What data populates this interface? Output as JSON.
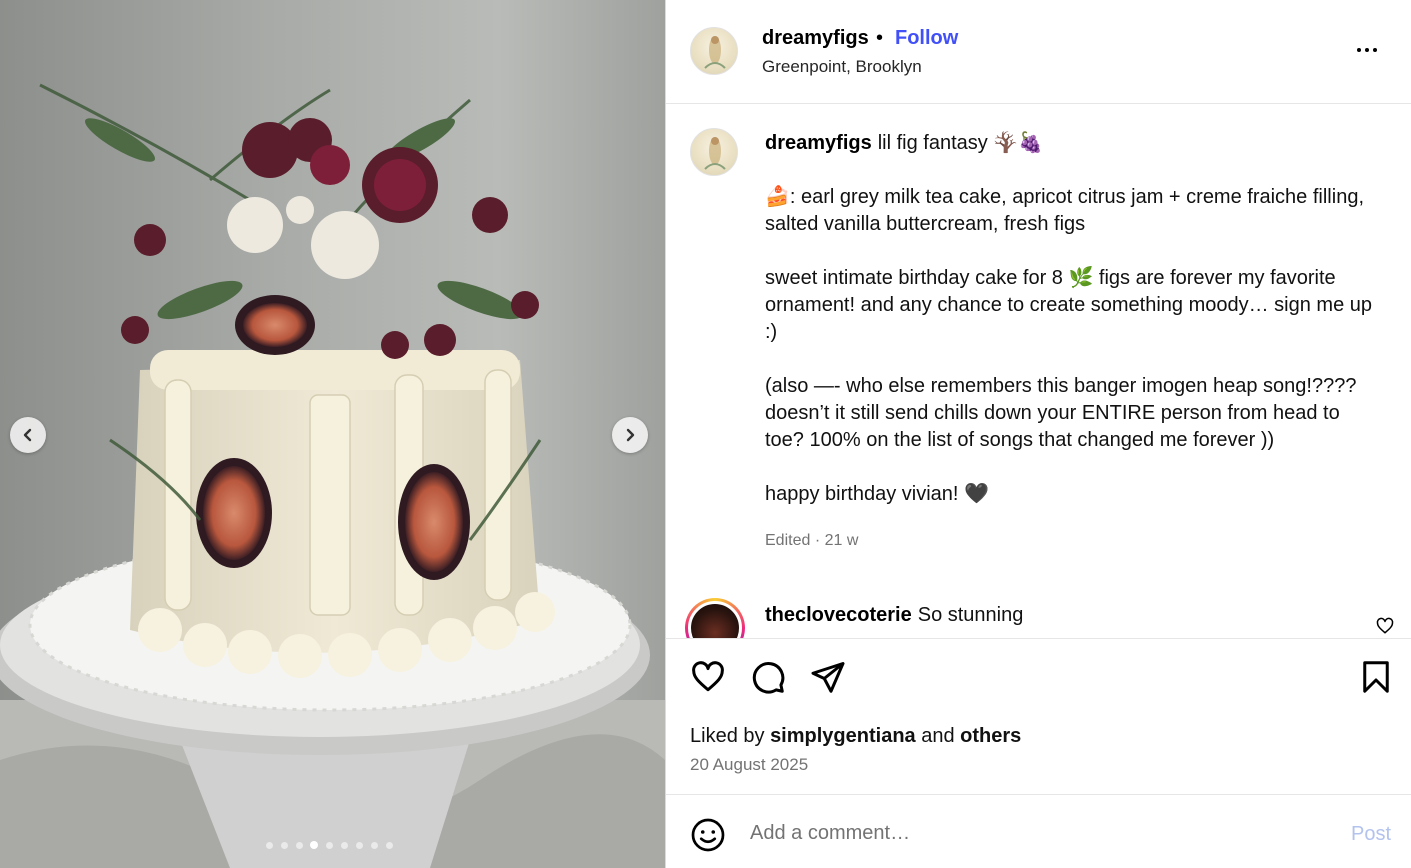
{
  "post": {
    "username": "dreamyfigs",
    "separator": "•",
    "follow_label": "Follow",
    "location": "Greenpoint, Brooklyn",
    "more_icon": "more-horizontal-icon"
  },
  "media": {
    "dot_count": 9,
    "active_dot": 3,
    "prev_icon": "chevron-left-icon",
    "next_icon": "chevron-right-icon"
  },
  "caption": {
    "username": "dreamyfigs",
    "line1": "lil fig fantasy 🪾🍇",
    "para2": "🍰: earl grey milk tea cake, apricot citrus jam + creme fraiche filling, salted vanilla buttercream, fresh figs",
    "para3": "sweet intimate birthday cake for 8 🌿  figs are forever my favorite ornament! and any chance to create something moody… sign me up :)",
    "para4": "(also —- who else remembers this banger imogen heap song!???? doesn’t it still send chills down your ENTIRE person from head to toe? 100% on the list of songs that changed me forever ))",
    "para5": "happy birthday vivian!  🖤",
    "edited": "Edited · 21 w"
  },
  "comment": {
    "username": "theclovecoterie",
    "text": "So stunning"
  },
  "actions": {
    "liked_by_prefix": "Liked by",
    "liked_by_user": "simplygentiana",
    "and": "and",
    "others": "others",
    "date": "20 August 2025"
  },
  "composer": {
    "placeholder": "Add a comment…",
    "post_label": "Post"
  },
  "colors": {
    "follow": "#4150f7",
    "post_disabled": "#b3c3ee",
    "muted": "#737373"
  }
}
